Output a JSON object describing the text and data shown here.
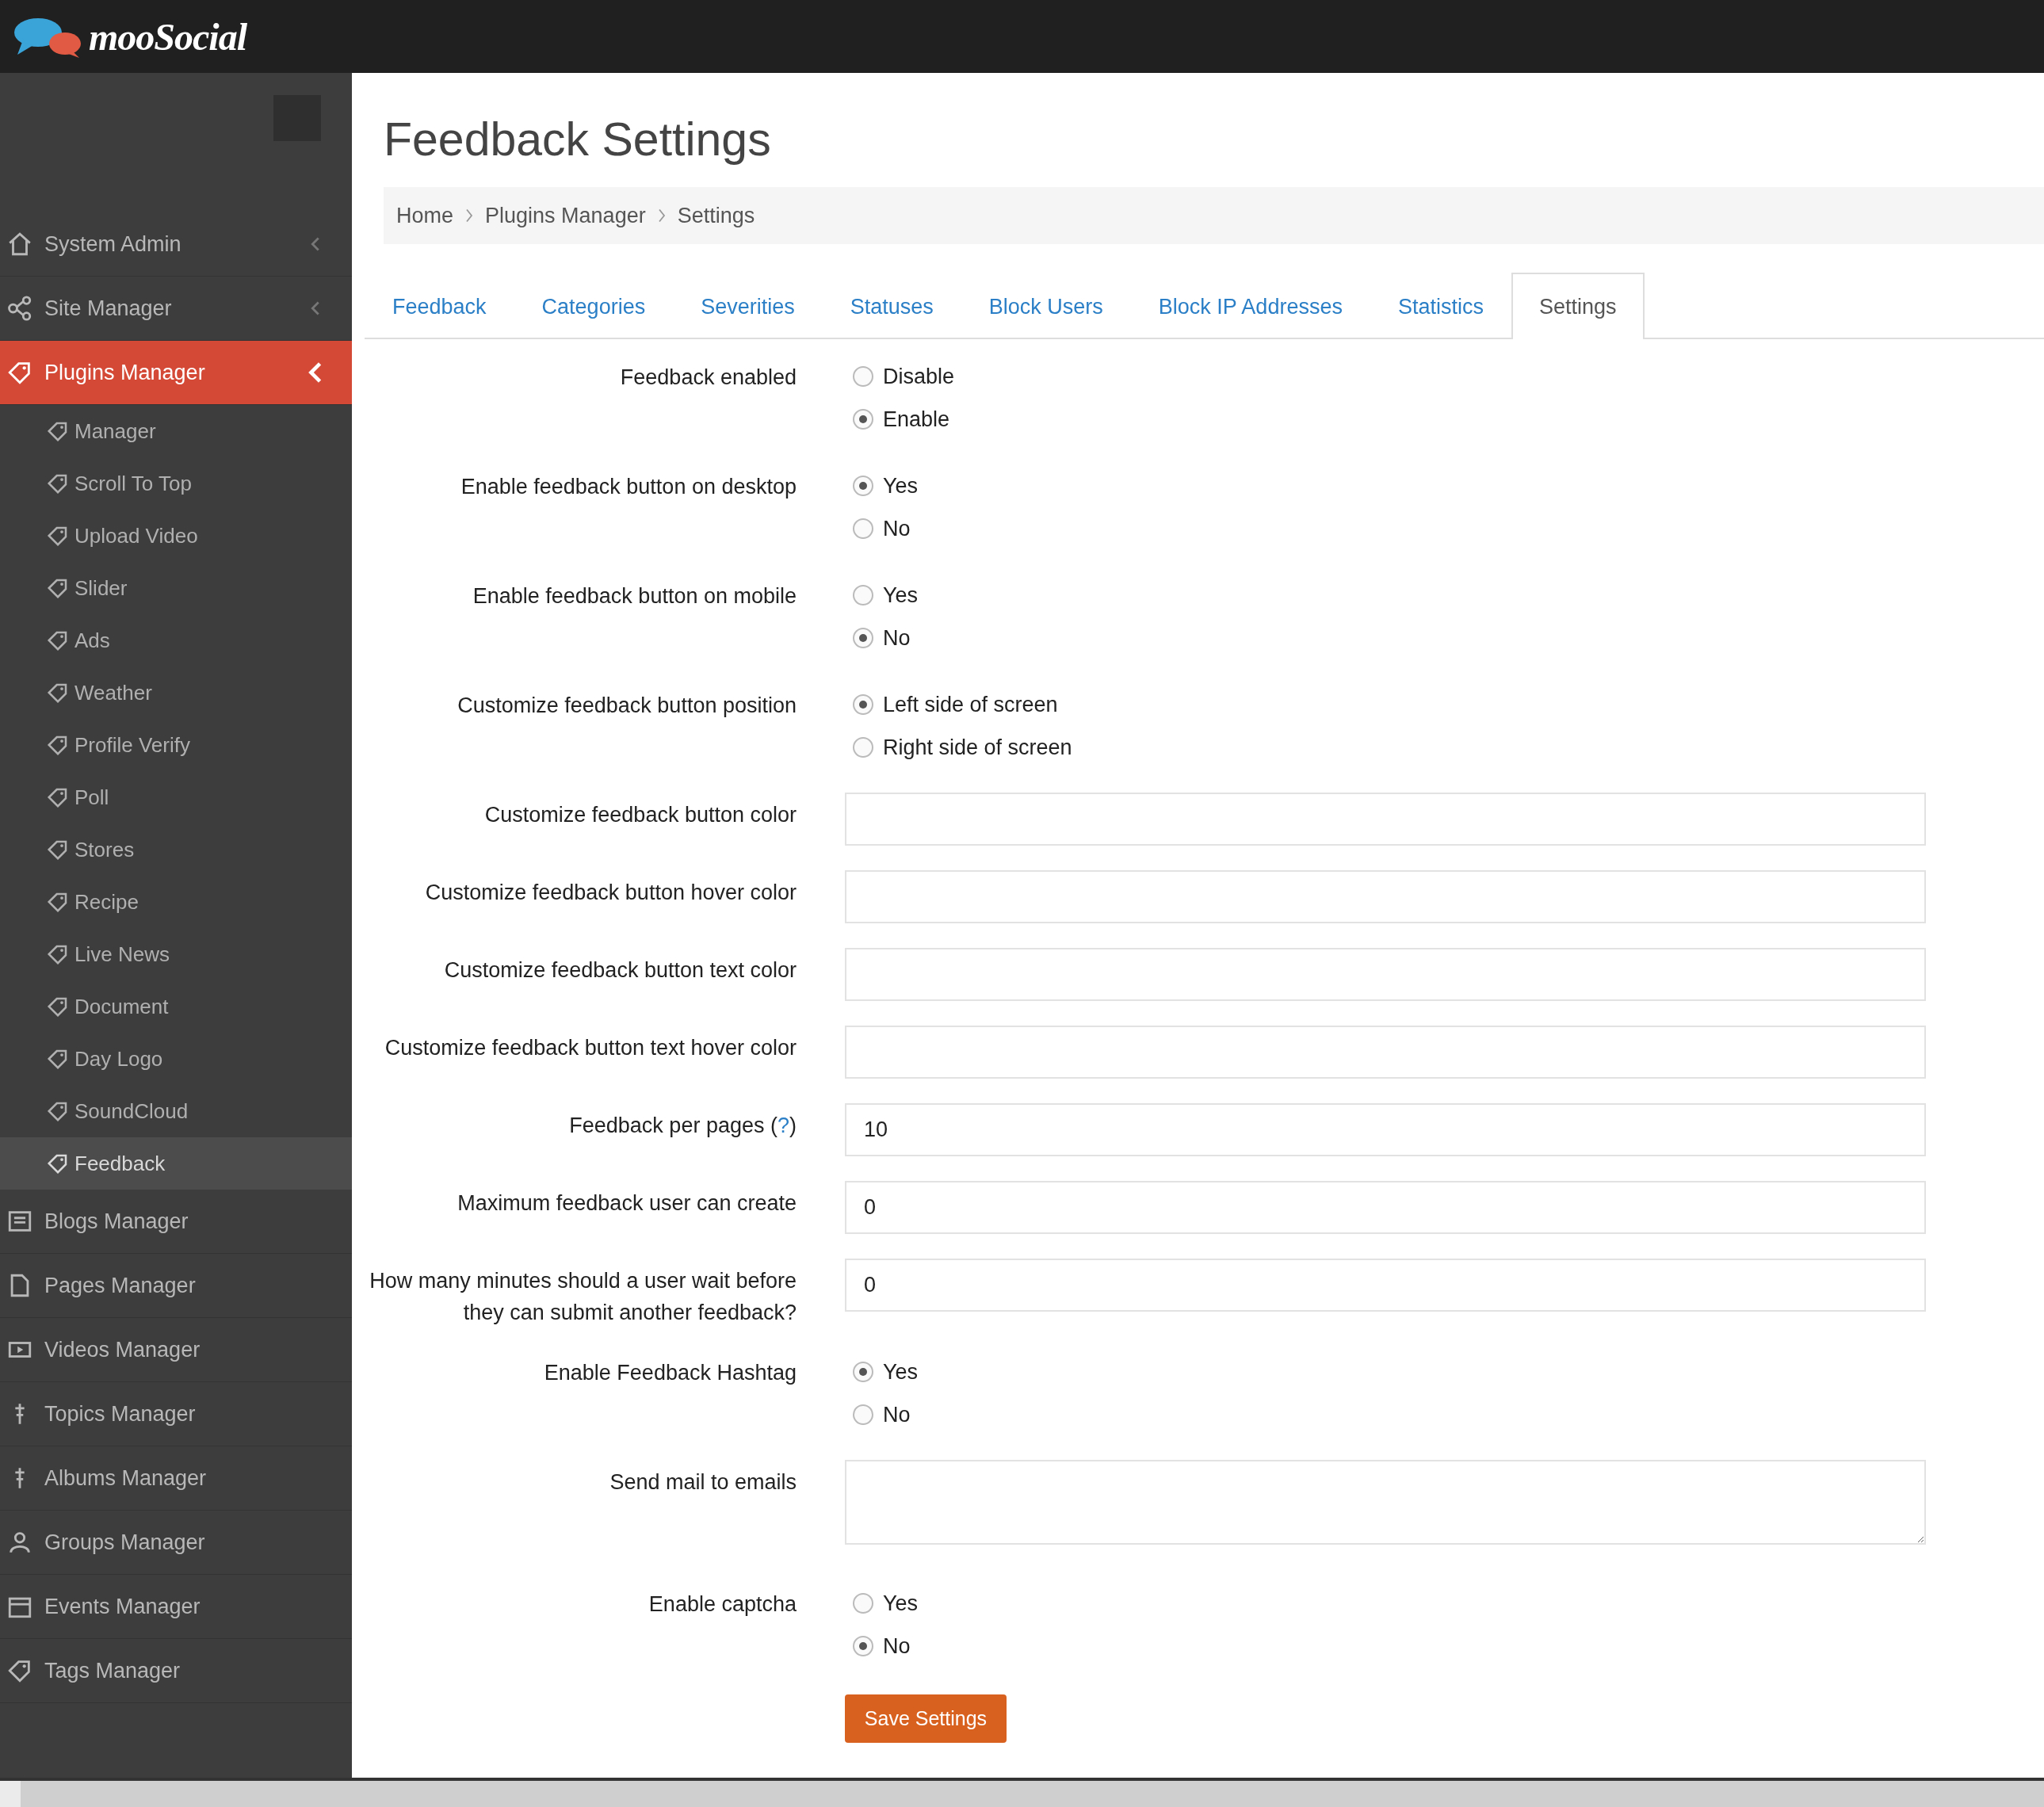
{
  "header": {
    "logo": "mooSocial"
  },
  "sidebar": {
    "items": [
      {
        "label": "System Admin",
        "kind": "home",
        "selected": false,
        "expanded": false
      },
      {
        "label": "Site Manager",
        "kind": "share",
        "selected": false,
        "expanded": false
      },
      {
        "label": "Plugins Manager",
        "kind": "tag",
        "selected": true,
        "expanded": true,
        "children": [
          {
            "label": "Manager",
            "kind": "tag",
            "selected": false
          },
          {
            "label": "Scroll To Top",
            "kind": "tag",
            "selected": false
          },
          {
            "label": "Upload Video",
            "kind": "tag",
            "selected": false
          },
          {
            "label": "Slider",
            "kind": "tag",
            "selected": false
          },
          {
            "label": "Ads",
            "kind": "tag",
            "selected": false
          },
          {
            "label": "Weather",
            "kind": "tag",
            "selected": false
          },
          {
            "label": "Profile Verify",
            "kind": "tag",
            "selected": false
          },
          {
            "label": "Poll",
            "kind": "tag",
            "selected": false
          },
          {
            "label": "Stores",
            "kind": "tag",
            "selected": false
          },
          {
            "label": "Recipe",
            "kind": "tag",
            "selected": false
          },
          {
            "label": "Live News",
            "kind": "tag",
            "selected": false
          },
          {
            "label": "Document",
            "kind": "tag",
            "selected": false
          },
          {
            "label": "Day Logo",
            "kind": "tag",
            "selected": false
          },
          {
            "label": "SoundCloud",
            "kind": "tag",
            "selected": false
          },
          {
            "label": "Feedback",
            "kind": "tag",
            "selected": true
          }
        ]
      },
      {
        "label": "Blogs Manager",
        "kind": "blog",
        "selected": false
      },
      {
        "label": "Pages Manager",
        "kind": "page",
        "selected": false
      },
      {
        "label": "Videos Manager",
        "kind": "video",
        "selected": false
      },
      {
        "label": "Topics Manager",
        "kind": "pin",
        "selected": false
      },
      {
        "label": "Albums Manager",
        "kind": "pin",
        "selected": false
      },
      {
        "label": "Groups Manager",
        "kind": "group",
        "selected": false
      },
      {
        "label": "Events Manager",
        "kind": "calendar",
        "selected": false
      },
      {
        "label": "Tags Manager",
        "kind": "tag",
        "selected": false
      }
    ]
  },
  "page": {
    "title": "Feedback Settings"
  },
  "breadcrumb": [
    "Home",
    "Plugins Manager",
    "Settings"
  ],
  "tabs": [
    {
      "label": "Feedback",
      "selected": false
    },
    {
      "label": "Categories",
      "selected": false
    },
    {
      "label": "Severities",
      "selected": false
    },
    {
      "label": "Statuses",
      "selected": false
    },
    {
      "label": "Block Users",
      "selected": false
    },
    {
      "label": "Block IP Addresses",
      "selected": false
    },
    {
      "label": "Statistics",
      "selected": false
    },
    {
      "label": "Settings",
      "selected": true
    }
  ],
  "form": {
    "fields": [
      {
        "kind": "radio",
        "label": "Feedback enabled",
        "options": [
          {
            "label": "Disable",
            "selected": false
          },
          {
            "label": "Enable",
            "selected": true
          }
        ]
      },
      {
        "kind": "radio",
        "label": "Enable feedback button on desktop",
        "options": [
          {
            "label": "Yes",
            "selected": true
          },
          {
            "label": "No",
            "selected": false
          }
        ]
      },
      {
        "kind": "radio",
        "label": "Enable feedback button on mobile",
        "options": [
          {
            "label": "Yes",
            "selected": false
          },
          {
            "label": "No",
            "selected": true
          }
        ]
      },
      {
        "kind": "radio",
        "label": "Customize feedback button position",
        "options": [
          {
            "label": "Left side of screen",
            "selected": true
          },
          {
            "label": "Right side of screen",
            "selected": false
          }
        ]
      },
      {
        "kind": "text",
        "label": "Customize feedback button color"
      },
      {
        "kind": "text",
        "label": "Customize feedback button hover color"
      },
      {
        "kind": "text",
        "label": "Customize feedback button text color"
      },
      {
        "kind": "text",
        "label": "Customize feedback button text hover color"
      },
      {
        "kind": "text",
        "label": "Feedback per pages (",
        "help": "?",
        "label_after": ")",
        "value": "10"
      },
      {
        "kind": "text",
        "label": "Maximum feedback user can create",
        "value": "0"
      },
      {
        "kind": "text",
        "label": "How many minutes should a user wait before they can submit another feedback?",
        "value": "0"
      },
      {
        "kind": "radio",
        "label": "Enable Feedback Hashtag",
        "options": [
          {
            "label": "Yes",
            "selected": true
          },
          {
            "label": "No",
            "selected": false
          }
        ]
      },
      {
        "kind": "textarea",
        "label": "Send mail to emails"
      },
      {
        "kind": "radio",
        "label": "Enable captcha",
        "options": [
          {
            "label": "Yes",
            "selected": false
          },
          {
            "label": "No",
            "selected": true
          }
        ]
      }
    ],
    "submit": "Save Settings"
  }
}
